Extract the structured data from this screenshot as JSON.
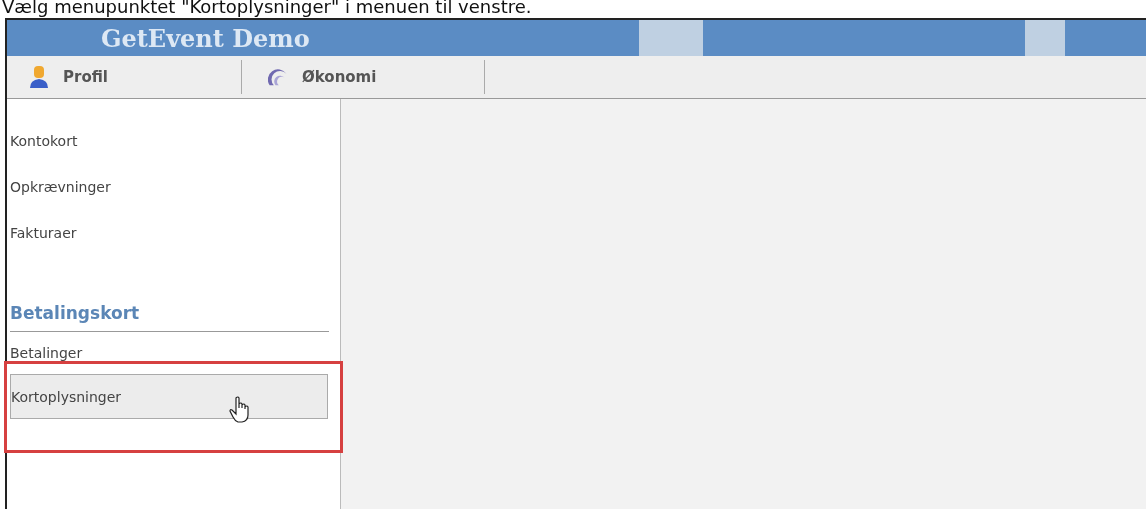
{
  "caption": "Vælg menupunktet \"Kortoplysninger\" i menuen til venstre.",
  "app": {
    "title": "GetEvent Demo"
  },
  "tabs": [
    {
      "label": "Profil",
      "kind": "person"
    },
    {
      "label": "Økonomi",
      "kind": "swirl"
    }
  ],
  "sidebar": {
    "groups": [
      {
        "items": [
          {
            "label": "Kontokort",
            "selected": false
          },
          {
            "label": "Opkrævninger",
            "selected": false
          },
          {
            "label": "Fakturaer",
            "selected": false
          }
        ]
      },
      {
        "heading": "Betalingskort",
        "items": [
          {
            "label": "Betalinger",
            "selected": false
          },
          {
            "label": "Kortoplysninger",
            "selected": true,
            "highlighted": true
          }
        ]
      }
    ]
  }
}
